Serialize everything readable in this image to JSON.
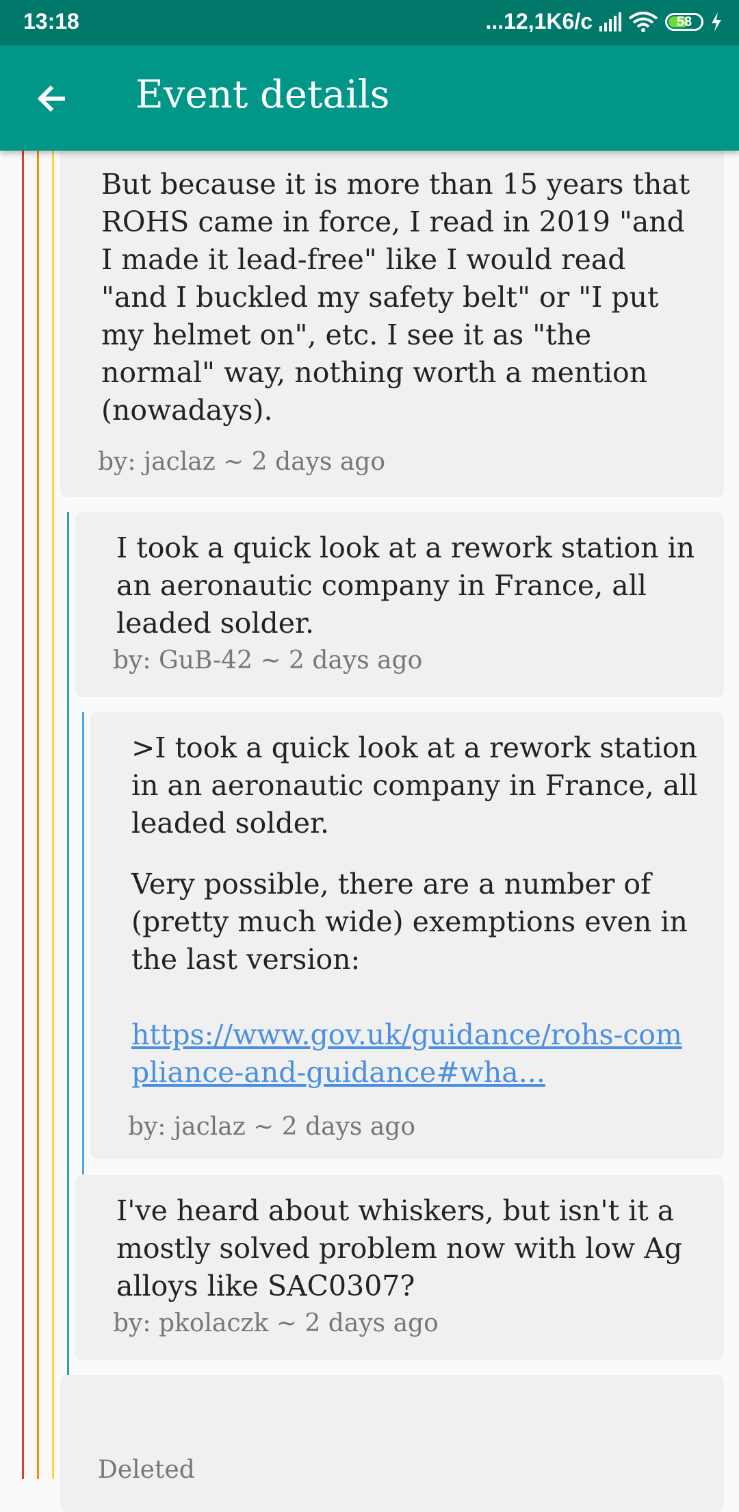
{
  "status_bar": {
    "time": "13:18",
    "network_speed": "...12,1K6/c",
    "battery": "58",
    "icons": [
      "signal-icon",
      "wifi-icon",
      "battery-icon",
      "charging-icon"
    ]
  },
  "app_bar": {
    "title": "Event details",
    "back_icon": "arrow-back-icon",
    "color": "#009688"
  },
  "thread_colors": [
    "#e53935",
    "#fb8c00",
    "#fdd835",
    "#26a69a",
    "#42a5f5"
  ],
  "comments": [
    {
      "text": "But because it is more than 15 years that ROHS came in force, I read in 2019 \"and I made it lead-free\" like I would read \"and I buckled my safety belt\" or \"I put my helmet on\", etc. I see it as \"the normal\" way, nothing worth a mention (nowadays).",
      "meta": "by: jaclaz ~ 2 days ago"
    },
    {
      "text": "I took a quick look at a rework station in an aeronautic company in France, all leaded solder.",
      "meta": "by: GuB-42 ~ 2 days ago"
    },
    {
      "quote": ">I took a quick look at a rework station in an aeronautic company in France, all leaded solder.",
      "text": "Very possible, there are a number of (pretty much wide) exemptions even in the last version:",
      "link": "https://www.gov.uk/guidance/rohs-compliance-and-guidance#wha...",
      "meta": "by: jaclaz ~ 2 days ago"
    },
    {
      "text": "I've heard about whiskers, but isn't it a mostly solved problem now with low Ag alloys like SAC0307?",
      "meta": "by: pkolaczk ~ 2 days ago"
    },
    {
      "text": "Deleted"
    }
  ]
}
